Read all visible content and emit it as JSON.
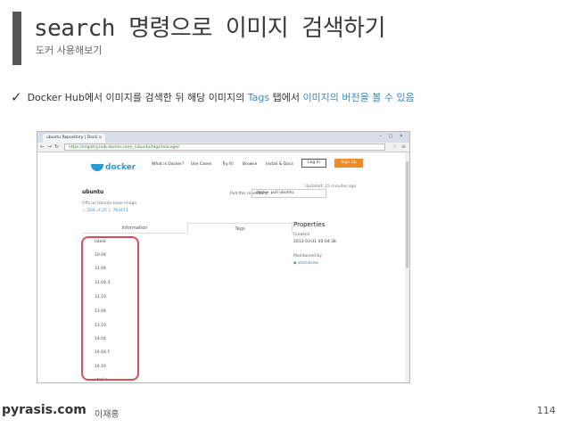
{
  "slide": {
    "title": "search 명령으로 이미지 검색하기",
    "subtitle": "도커 사용해보기",
    "bullet_pre": "Docker Hub에서 이미지를 검색한 뒤 해당 이미지의 ",
    "bullet_tags": "Tags",
    "bullet_mid": " 탭에서 ",
    "bullet_versions": "이미지의 버전을 볼 수 있음",
    "footer_brand": "pyrasis.com",
    "footer_author": "이재홍",
    "page_number": "114",
    "accent_color": "#3b8bbd",
    "highlight_color": "#e04b5c"
  },
  "browser": {
    "tab_title": "ubuntu Repository | Dock ×",
    "url": "https://registry.hub.docker.com/_/ubuntu/tags/manage/",
    "back_icon": "arrow-left-icon",
    "forward_icon": "arrow-right-icon",
    "reload_icon": "reload-icon",
    "menu_icon": "hamburger-menu-icon"
  },
  "site": {
    "logo": "docker",
    "nav": [
      "What is Docker?",
      "Use Cases",
      "Try It!",
      "Browse",
      "Install & Docs"
    ],
    "login": "Log In",
    "signup": "Sign Up",
    "updated": "Updated: 15 minutes ago",
    "repo_name": "ubuntu",
    "repo_desc": "Official Ubuntu base image",
    "stats": "☆ 528  ⎇ 25  ⇩ 763471",
    "pull_label": "Pull this repository",
    "pull_cmd": "docker pull ubuntu",
    "tabs": [
      "Information",
      "Tags"
    ],
    "tags": [
      "latest",
      "10.04",
      "12.04",
      "12.04.3",
      "12.10",
      "13.04",
      "13.10",
      "14.04",
      "14.04.1",
      "14.10",
      "utopic"
    ],
    "properties_title": "Properties",
    "created_label": "Created",
    "created_value": "2013-03-01 00:04:38",
    "maintained_label": "Maintained by",
    "maintainer": "stackbrew"
  }
}
